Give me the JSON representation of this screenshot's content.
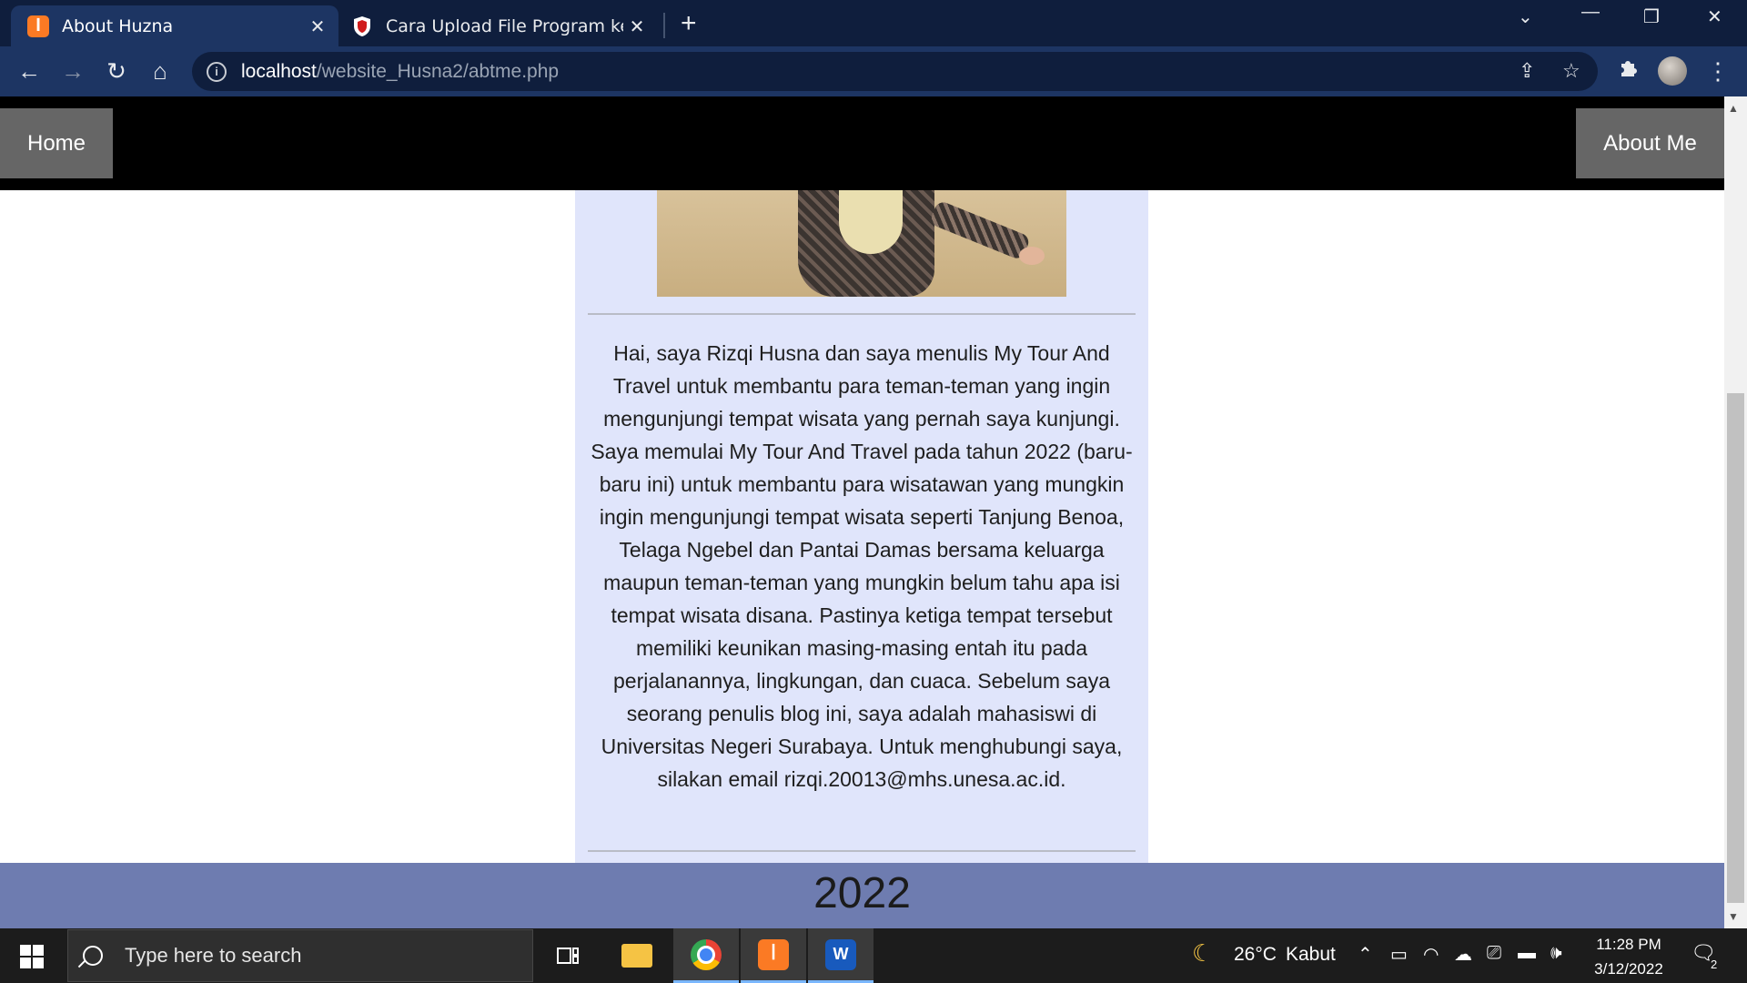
{
  "browser": {
    "tabs": [
      {
        "title": "About Huzna",
        "favicon": "xampp-icon",
        "active": true
      },
      {
        "title": "Cara Upload File Program ke GitHub",
        "favicon": "shield-icon",
        "active": false
      }
    ],
    "new_tab_label": "+",
    "url_host": "localhost",
    "url_path": "/website_Husna2/abtme.php"
  },
  "page": {
    "nav": {
      "home": "Home",
      "about": "About Me"
    },
    "bio": "Hai, saya Rizqi Husna dan saya menulis My Tour And Travel untuk membantu para teman-teman yang ingin mengunjungi tempat wisata yang pernah saya kunjungi. Saya memulai My Tour And Travel pada tahun 2022 (baru-baru ini) untuk membantu para wisatawan yang mungkin ingin mengunjungi tempat wisata seperti Tanjung Benoa, Telaga Ngebel dan Pantai Damas bersama keluarga maupun teman-teman yang mungkin belum tahu apa isi tempat wisata disana. Pastinya ketiga tempat tersebut memiliki keunikan masing-masing entah itu pada perjalanannya, lingkungan, dan cuaca. Sebelum saya seorang penulis blog ini, saya adalah mahasiswi di Universitas Negeri Surabaya. Untuk menghubungi saya, silakan email rizqi.20013@mhs.unesa.ac.id.",
    "footer_year": "2022"
  },
  "taskbar": {
    "search_placeholder": "Type here to search",
    "weather_temp": "26°C",
    "weather_desc": "Kabut",
    "time": "11:28 PM",
    "date": "3/12/2022",
    "notification_count": "2"
  },
  "colors": {
    "tab_strip": "#0f1e3d",
    "toolbar": "#1d3563",
    "content_box": "#e0e5fb",
    "footer": "#6e7cb0",
    "nav_button": "#666666"
  }
}
